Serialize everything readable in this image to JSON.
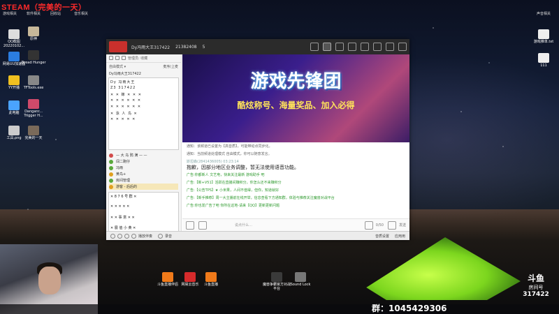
{
  "overlay": {
    "stream_title": "STEAM（完美的一天）",
    "group_number": "群：1045429306",
    "room_label": "房间号",
    "room_number": "317422",
    "room_title": "斗鱼"
  },
  "desktop": {
    "top_labels": [
      "游戏相关",
      "软件相关",
      "回收站",
      "音乐相关"
    ],
    "top_right_label": "声音相关",
    "left_icons": [
      {
        "label": "QQ截图20220102...",
        "icon": "image-icon"
      },
      {
        "label": "原神",
        "icon": "game-icon"
      },
      {
        "label": "网易UU加速器",
        "icon": "uu-icon"
      },
      {
        "label": "Dread Hunger",
        "icon": "game-icon"
      },
      {
        "label": "YY开播",
        "icon": "yy-icon"
      },
      {
        "label": "TFTools.exe",
        "icon": "exe-icon"
      },
      {
        "label": "此电脑",
        "icon": "computer-icon"
      },
      {
        "label": "Danganr... Trigger H...",
        "icon": "game-icon"
      },
      {
        "label": "工具.png",
        "icon": "image-icon"
      },
      {
        "label": "完美的一天",
        "icon": "game-icon"
      }
    ],
    "right_icons": [
      {
        "label": "游戏推单.txt",
        "icon": "file-icon"
      },
      {
        "label": "111",
        "icon": "file-icon"
      }
    ],
    "bottom_icons": [
      {
        "label": "斗鱼直播伴侣",
        "icon": "douyu-icon"
      },
      {
        "label": "网易云音乐",
        "icon": "music-icon"
      },
      {
        "label": "斗鱼直播",
        "icon": "douyu-icon"
      },
      {
        "label": "魔兽争霸官方对战平台",
        "icon": "warcraft-icon"
      },
      {
        "label": "Sound Lock",
        "icon": "lock-icon"
      }
    ]
  },
  "app": {
    "window_title": "Dy冯雨大王317422",
    "id_text": "21382408",
    "count_text": "5",
    "left_header_text": "管理员: 收藏",
    "mode_label": "自由模式 ▾",
    "mode_right": "麦序/上麦",
    "user_name": "Dy冯雨大王317422",
    "grid_rows": [
      "Dy    冯雨大王",
      "Z3    317422",
      "✕ ✕ 嫁 ✕ ✕ ✕",
      "✕ ✕ ✕ ✕ ✕ ✕",
      "✕ ✕ ✕ ✕ ✕ ✕",
      "✕ 泳 人 鸟 ✕",
      "✕ ✕ ✕ ✕ ✕"
    ],
    "roles": [
      {
        "label": "— 大 乌 鸦 满 — —",
        "color": "#d24b4b"
      },
      {
        "label": "闯二跑仔",
        "color": "#5aa83c"
      },
      {
        "label": "冯雨",
        "color": "#5aa83c"
      },
      {
        "label": "黄鸟+",
        "color": "#e0a020"
      },
      {
        "label": "房间管理",
        "color": "#5aa83c"
      },
      {
        "label": "游客 - 后后的",
        "color": "#e0a020"
      }
    ],
    "grid2_rows": [
      "✕ 8 7 6 号 群 ✕",
      "✕ ✕ ✕ ✕ ✕",
      "✕ ✕ 事 意 ✕ ✕",
      "✕ 展 值 小 黄 ✕"
    ],
    "banner_title": "游戏先锋团",
    "banner_sub": "酷炫称号、海量奖品、加入必得",
    "chat": [
      {
        "type": "sys",
        "text": "通知：该频道已设置为【高音质】，可能带动点同步化。"
      },
      {
        "type": "sys",
        "text": "通知：当前频道处理模式 自由模式，你可以随意发言。"
      },
      {
        "type": "who",
        "text": "斯坦森(2841436005)  03:23:14"
      },
      {
        "type": "big",
        "text": "抱歉，因部分地区业务调整，暂无法使用语音功能。"
      },
      {
        "type": "ad",
        "text": "广告:你都新人 文艺电，快来关注最新 游戏助手 吧"
      },
      {
        "type": "ad",
        "text": "广告:【新+V51】活跃在直播间赚积分，你怎么还不来赚积分"
      },
      {
        "type": "ad",
        "text": "广告:【公告TPS】★ 小米果，人间不值得，但你，知道就好"
      },
      {
        "type": "ad",
        "text": "广告:【新手推荐】周一大主播前在线开举，信息查看下方通知群，体验与推荐关注魔兽对战平台"
      },
      {
        "type": "ad",
        "text": "广告:你也发广告了吧 你所在这地-请来【QQ】更新更新问题"
      }
    ],
    "input_placeholder": "说点什么…",
    "char_limit": "0/50",
    "send_label": "发送",
    "bottom_items": [
      "播放伴奏",
      "录音"
    ],
    "bottom_right": [
      "音质设置",
      "应用用"
    ]
  }
}
